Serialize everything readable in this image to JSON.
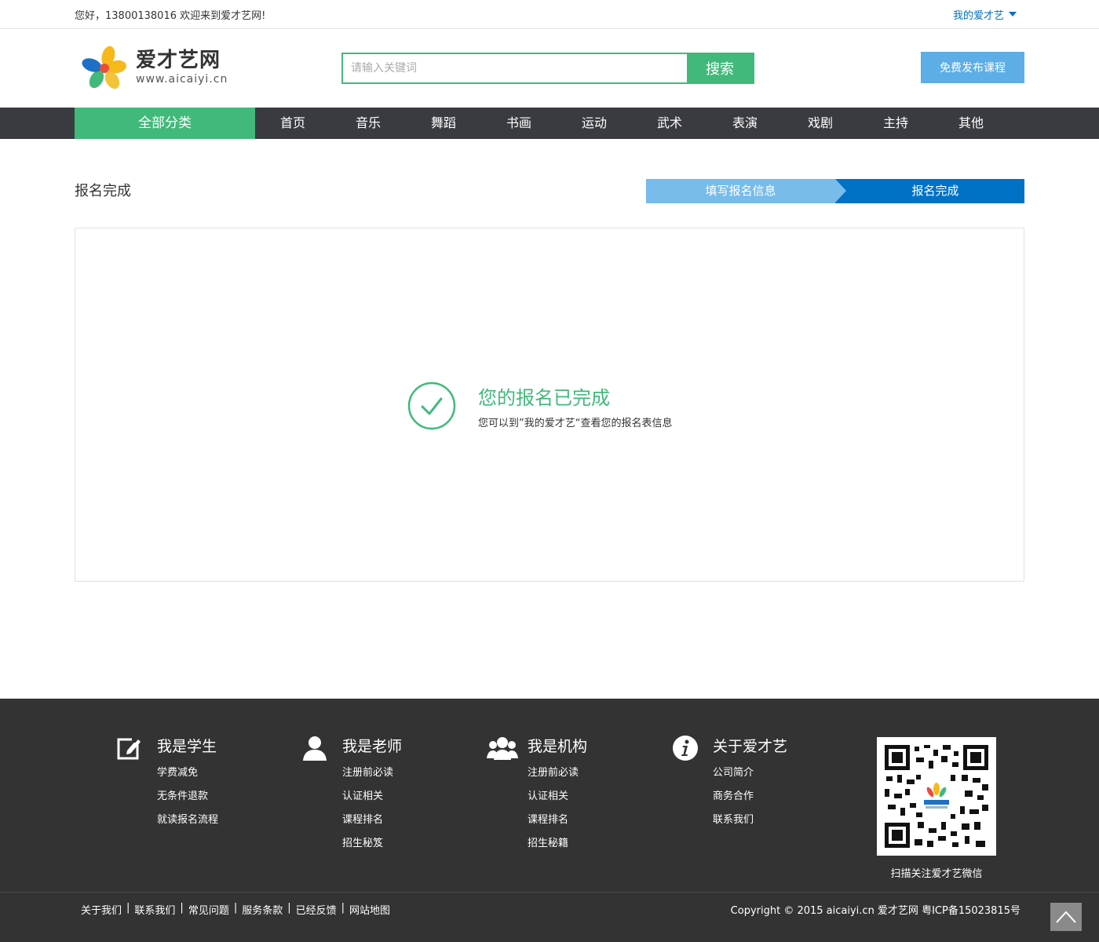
{
  "topbar": {
    "greeting": "您好，13800138016 欢迎来到爱才艺网!",
    "my_account": "我的爱才艺"
  },
  "header": {
    "logo_name": "爱才艺网",
    "logo_url": "www.aicaiyi.cn",
    "search_placeholder": "请输入关键词",
    "search_button": "搜索",
    "publish_button": "免费发布课程"
  },
  "nav": {
    "all_categories": "全部分类",
    "items": [
      "首页",
      "音乐",
      "舞蹈",
      "书画",
      "运动",
      "武术",
      "表演",
      "戏剧",
      "主持",
      "其他"
    ]
  },
  "main": {
    "page_title": "报名完成",
    "steps": [
      "填写报名信息",
      "报名完成"
    ],
    "result_title": "您的报名已完成",
    "result_subtitle": "您可以到”我的爱才艺“查看您的报名表信息"
  },
  "footer": {
    "columns": [
      {
        "icon": "edit-icon",
        "title": "我是学生",
        "links": [
          "学费减免",
          "无条件退款",
          "就读报名流程"
        ]
      },
      {
        "icon": "user-icon",
        "title": "我是老师",
        "links": [
          "注册前必读",
          "认证相关",
          "课程排名",
          "招生秘笈"
        ]
      },
      {
        "icon": "group-icon",
        "title": "我是机构",
        "links": [
          "注册前必读",
          "认证相关",
          "课程排名",
          "招生秘籍"
        ]
      },
      {
        "icon": "info-icon",
        "title": "关于爱才艺",
        "links": [
          "公司简介",
          "商务合作",
          "联系我们"
        ]
      }
    ],
    "qr_caption": "扫描关注爱才艺微信",
    "bottom_links": [
      "关于我们",
      "联系我们",
      "常见问题",
      "服务条款",
      "已经反馈",
      "网站地图"
    ],
    "copyright": "Copyright © 2015 aicaiyi.cn 爱才艺网 粤ICP备15023815号"
  },
  "colors": {
    "brand_green": "#41b97a",
    "brand_blue": "#0072c6",
    "light_blue": "#77bceb",
    "nav_dark": "#3a3b40",
    "footer_dark": "#333333"
  }
}
